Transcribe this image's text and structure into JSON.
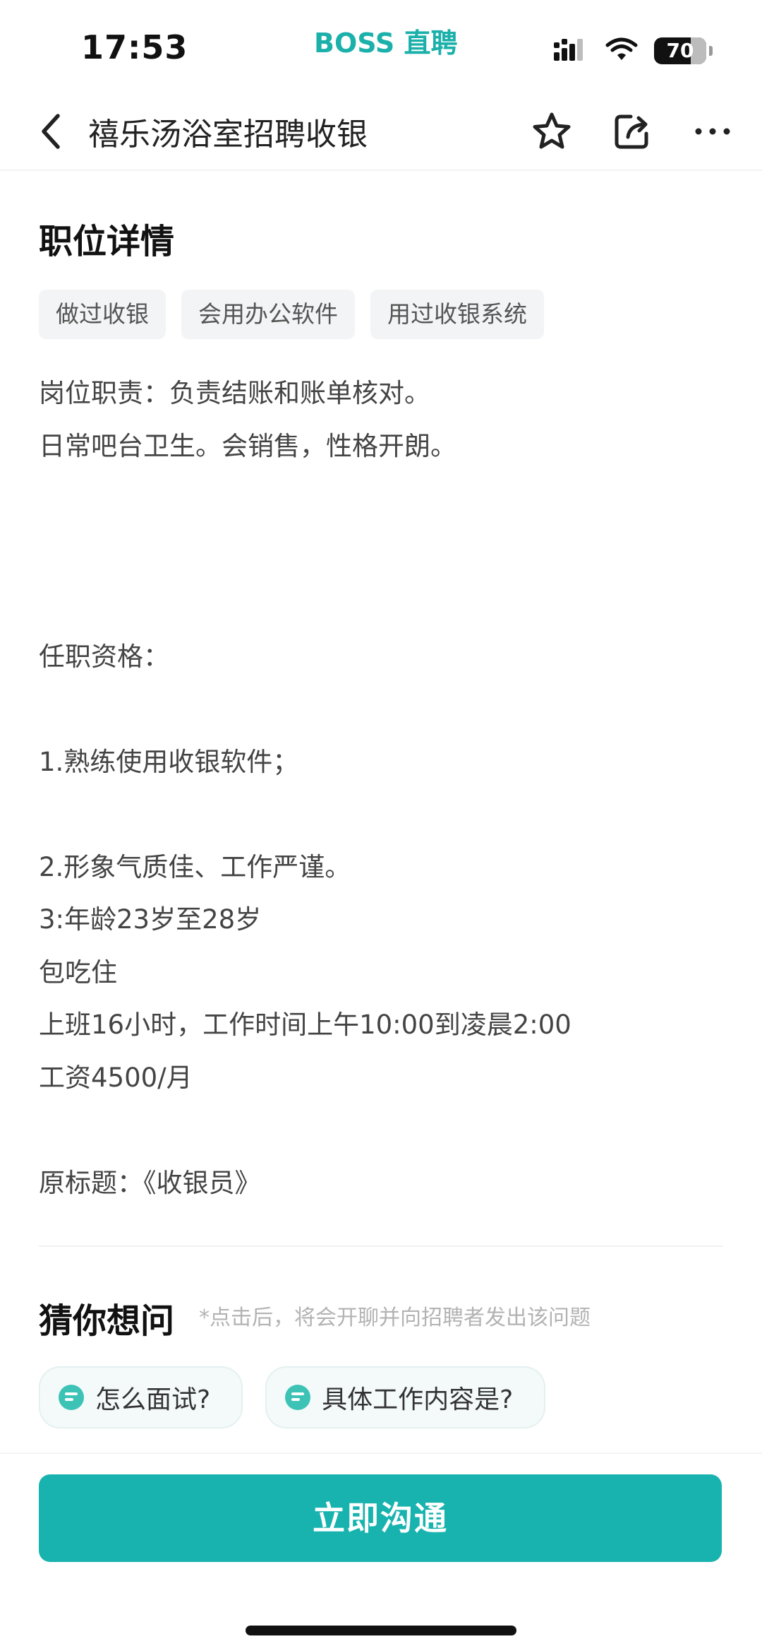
{
  "status_bar": {
    "time": "17:53",
    "brand": "BOSS 直聘",
    "battery": "70",
    "icons": [
      "cellular-signal-icon",
      "wifi-icon",
      "battery-icon"
    ]
  },
  "nav": {
    "title": "禧乐汤浴室招聘收银",
    "icons": [
      "back-arrow-icon",
      "star-icon",
      "share-icon",
      "more-icon"
    ]
  },
  "job_detail": {
    "section_title": "职位详情",
    "tags": [
      "做过收银",
      "会用办公软件",
      "用过收银系统"
    ],
    "description_lines": [
      "岗位职责：负责结账和账单核对。",
      "日常吧台卫生。会销售，性格开朗。",
      "",
      "",
      "",
      "任职资格：",
      "",
      "1.熟练使用收银软件；",
      "",
      "2.形象气质佳、工作严谨。",
      "3:年龄23岁至28岁",
      "包吃住",
      "上班16小时，工作时间上午10:00到凌晨2:00",
      "工资4500/月",
      "",
      "原标题：《收银员》"
    ]
  },
  "guess": {
    "title": "猜你想问",
    "hint": "*点击后，将会开聊并向招聘者发出该问题",
    "questions": [
      "怎么面试?",
      "具体工作内容是?"
    ]
  },
  "cta": {
    "label": "立即沟通"
  },
  "colors": {
    "accent": "#18b3af",
    "brand": "#1bb0aa"
  }
}
